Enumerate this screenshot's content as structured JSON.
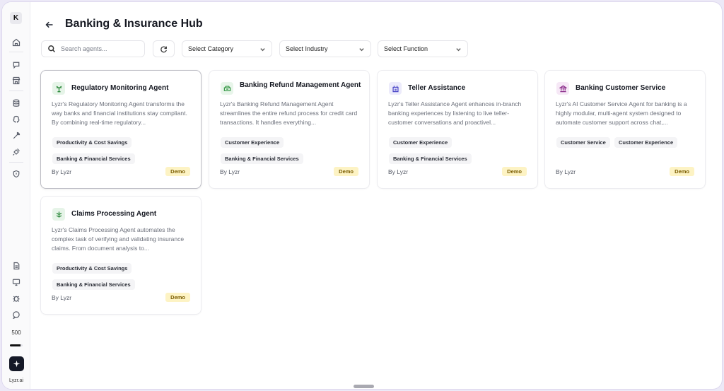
{
  "sidebar": {
    "avatar_letter": "K",
    "icons": [
      "home-icon",
      "chat-icon",
      "store-icon",
      "database-icon",
      "brain-icon",
      "tool-icon",
      "plug-icon",
      "shield-icon",
      "document-icon",
      "monitor-icon",
      "bug-icon",
      "message-icon"
    ],
    "credits": "500",
    "credits_progress": 0.85,
    "brand": "Lyzr.ai"
  },
  "header": {
    "title": "Banking & Insurance Hub"
  },
  "filters": {
    "search_placeholder": "Search agents...",
    "category": "Select Category",
    "industry": "Select Industry",
    "function": "Select Function"
  },
  "cards": [
    {
      "title": "Regulatory Monitoring Agent",
      "icon": "regulation-icon",
      "icon_color": "#2f8a3e",
      "icon_bg": "#e6f4e8",
      "description": "Lyzr's Regulatory Monitoring Agent transforms the way banks and financial institutions stay compliant. By combining real-time regulatory...",
      "tags": [
        "Productivity & Cost Savings",
        "Banking & Financial Services"
      ],
      "author": "By Lyzr",
      "badge": "Demo"
    },
    {
      "title": "Banking Refund Management Agent",
      "icon": "refund-icon",
      "icon_color": "#3a9a4a",
      "icon_bg": "#e8f5ea",
      "description": "Lyzr's Banking Refund Management Agent streamlines the entire refund process for credit card transactions. It handles everything...",
      "tags": [
        "Customer Experience",
        "Banking & Financial Services"
      ],
      "author": "By Lyzr",
      "badge": "Demo"
    },
    {
      "title": "Teller Assistance",
      "icon": "teller-icon",
      "icon_color": "#4a46c8",
      "icon_bg": "#ecebfb",
      "description": "Lyzr's Teller Assistance Agent enhances in-branch banking experiences by listening to live teller-customer conversations and proactivel...",
      "tags": [
        "Customer Experience",
        "Banking & Financial Services"
      ],
      "author": "By Lyzr",
      "badge": "Demo"
    },
    {
      "title": "Banking Customer Service",
      "icon": "bank-icon",
      "icon_color": "#8a2c8a",
      "icon_bg": "#f6e8f6",
      "description": "Lyzr's AI Customer Service Agent for banking is a highly modular, multi-agent system designed to automate customer support across chat,...",
      "tags": [
        "Customer Service",
        "Customer Experience"
      ],
      "author": "By Lyzr",
      "badge": "Demo"
    },
    {
      "title": "Claims Processing Agent",
      "icon": "claims-icon",
      "icon_color": "#2f8a3e",
      "icon_bg": "#e6f4e8",
      "description": "Lyzr's Claims Processing Agent automates the complex task of verifying and validating insurance claims. From document analysis to...",
      "tags": [
        "Productivity & Cost Savings",
        "Banking & Financial Services"
      ],
      "author": "By Lyzr",
      "badge": "Demo"
    }
  ]
}
